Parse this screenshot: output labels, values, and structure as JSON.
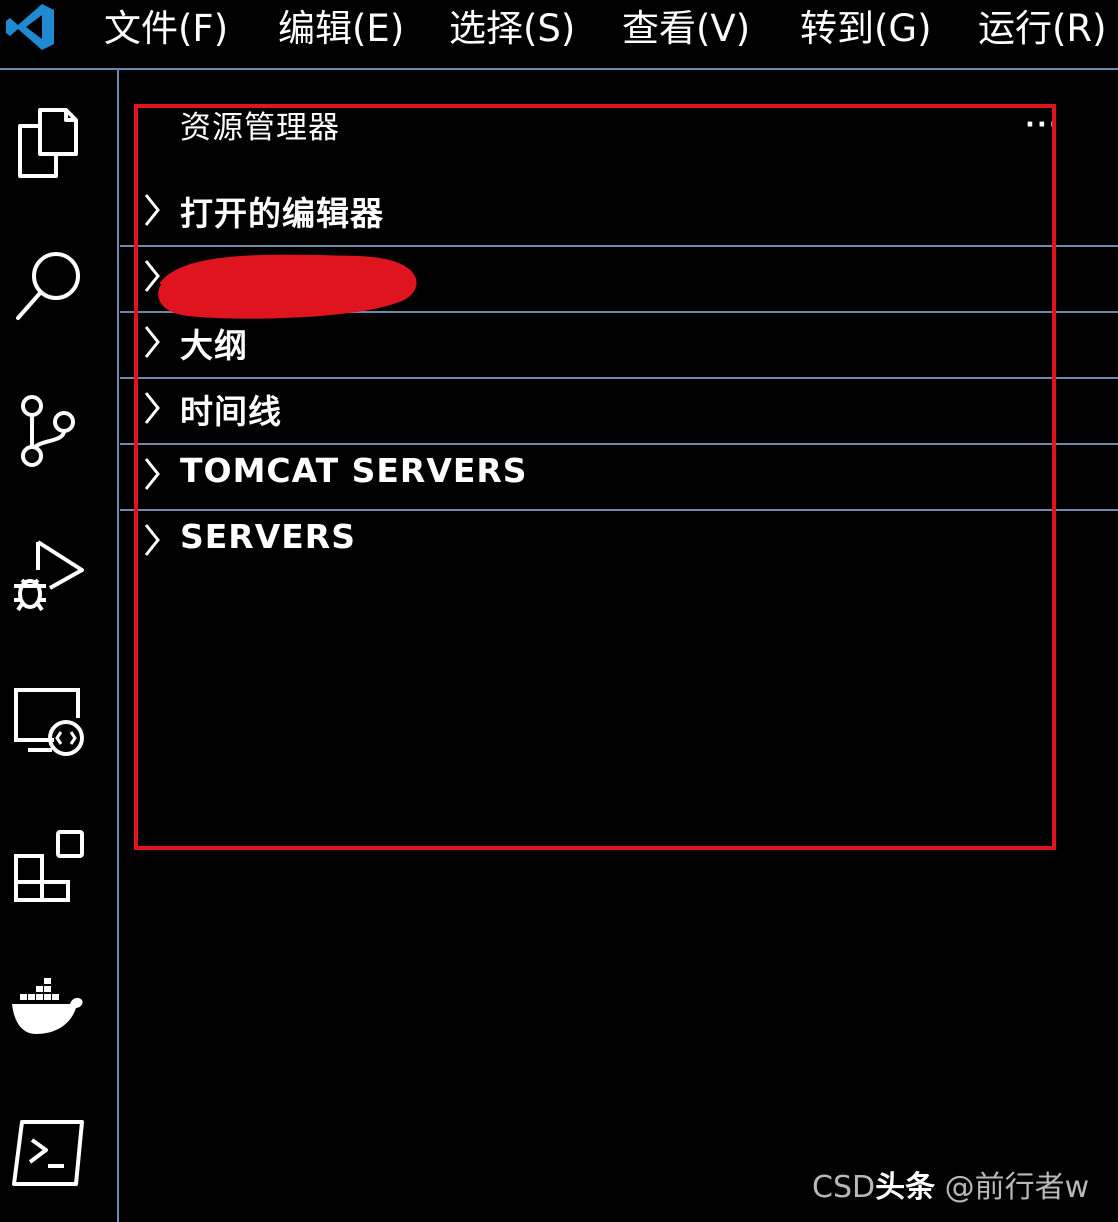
{
  "app": {
    "logo": "vscode-logo-icon",
    "brand_color": "#1f8ad2"
  },
  "menu": [
    {
      "label": "文件(F)"
    },
    {
      "label": "编辑(E)"
    },
    {
      "label": "选择(S)"
    },
    {
      "label": "查看(V)"
    },
    {
      "label": "转到(G)"
    },
    {
      "label": "运行(R)"
    }
  ],
  "activity_bar": [
    {
      "icon": "explorer-files-icon"
    },
    {
      "icon": "search-icon"
    },
    {
      "icon": "source-control-icon"
    },
    {
      "icon": "run-debug-icon"
    },
    {
      "icon": "remote-explorer-icon"
    },
    {
      "icon": "extensions-icon"
    },
    {
      "icon": "docker-icon"
    },
    {
      "icon": "terminal-icon"
    }
  ],
  "sidebar": {
    "title": "资源管理器",
    "more": "···",
    "sections": [
      {
        "label": "打开的编辑器"
      },
      {
        "label": ""
      },
      {
        "label": "大纲"
      },
      {
        "label": "时间线"
      },
      {
        "label": "TOMCAT SERVERS"
      },
      {
        "label": "SERVERS"
      }
    ]
  },
  "annotation": {
    "highlight_color": "#e0141e",
    "redaction_color": "#e0141e"
  },
  "watermark": {
    "prefix": "CSD",
    "strong": "头条",
    "suffix": " @前行者w"
  },
  "colors": {
    "background": "#000000",
    "divider": "#6f8aa8",
    "text": "#ffffff"
  }
}
